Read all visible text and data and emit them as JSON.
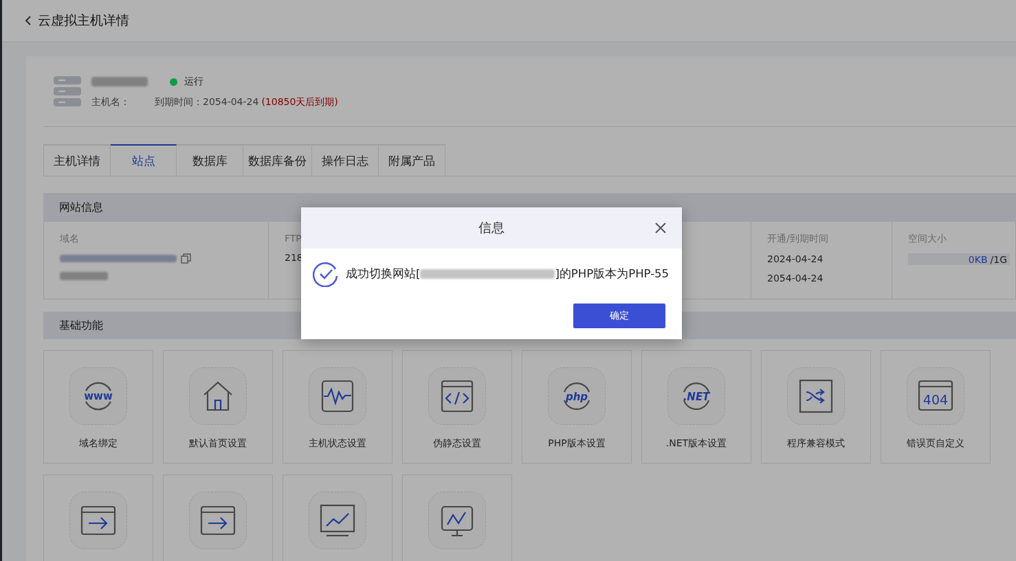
{
  "header": {
    "title": "云虚拟主机详情"
  },
  "host": {
    "status": {
      "label": "运行",
      "color": "#129a45"
    },
    "hostname_label": "主机名：",
    "expire_label": "到期时间：2054-04-24",
    "expire_remaining": "(10850天后到期)"
  },
  "tabs": [
    {
      "label": "主机详情",
      "selected": false
    },
    {
      "label": "站点",
      "selected": true
    },
    {
      "label": "数据库",
      "selected": false
    },
    {
      "label": "数据库备份",
      "selected": false
    },
    {
      "label": "操作日志",
      "selected": false
    },
    {
      "label": "附属产品",
      "selected": false
    }
  ],
  "site_info": {
    "title": "网站信息",
    "columns": [
      {
        "kind": "domain",
        "label": "域名"
      },
      {
        "kind": "plain",
        "label": "FTP",
        "values": [
          "218"
        ]
      },
      {
        "kind": "dates",
        "label": "开通/到期时间",
        "values": [
          "2024-04-24",
          "2054-04-24"
        ]
      },
      {
        "kind": "usage",
        "label": "空间大小",
        "used": "0KB",
        "total": "/1G",
        "level": 0
      }
    ]
  },
  "features": {
    "title": "基础功能",
    "items": [
      {
        "kind": "www",
        "icon_text": "www",
        "label": "域名绑定"
      },
      {
        "kind": "home",
        "label": "默认首页设置"
      },
      {
        "kind": "pulse",
        "label": "主机状态设置"
      },
      {
        "kind": "code",
        "label": "伪静态设置"
      },
      {
        "kind": "ring",
        "icon_text": "php",
        "label": "PHP版本设置"
      },
      {
        "kind": "ring",
        "icon_text": ".NET",
        "label": ".NET版本设置"
      },
      {
        "kind": "shuffle",
        "label": "程序兼容模式"
      },
      {
        "kind": "window-text",
        "icon_text": "404",
        "label": "错误页自定义"
      },
      {
        "kind": "window-arrow"
      },
      {
        "kind": "window-arrow"
      },
      {
        "kind": "monitor-chart"
      },
      {
        "kind": "monitor-zigzag"
      }
    ]
  },
  "dialog": {
    "title": "信息",
    "message_prefix": "成功切换网站[",
    "message_suffix": "]的PHP版本为PHP-55",
    "confirm": "确定"
  }
}
